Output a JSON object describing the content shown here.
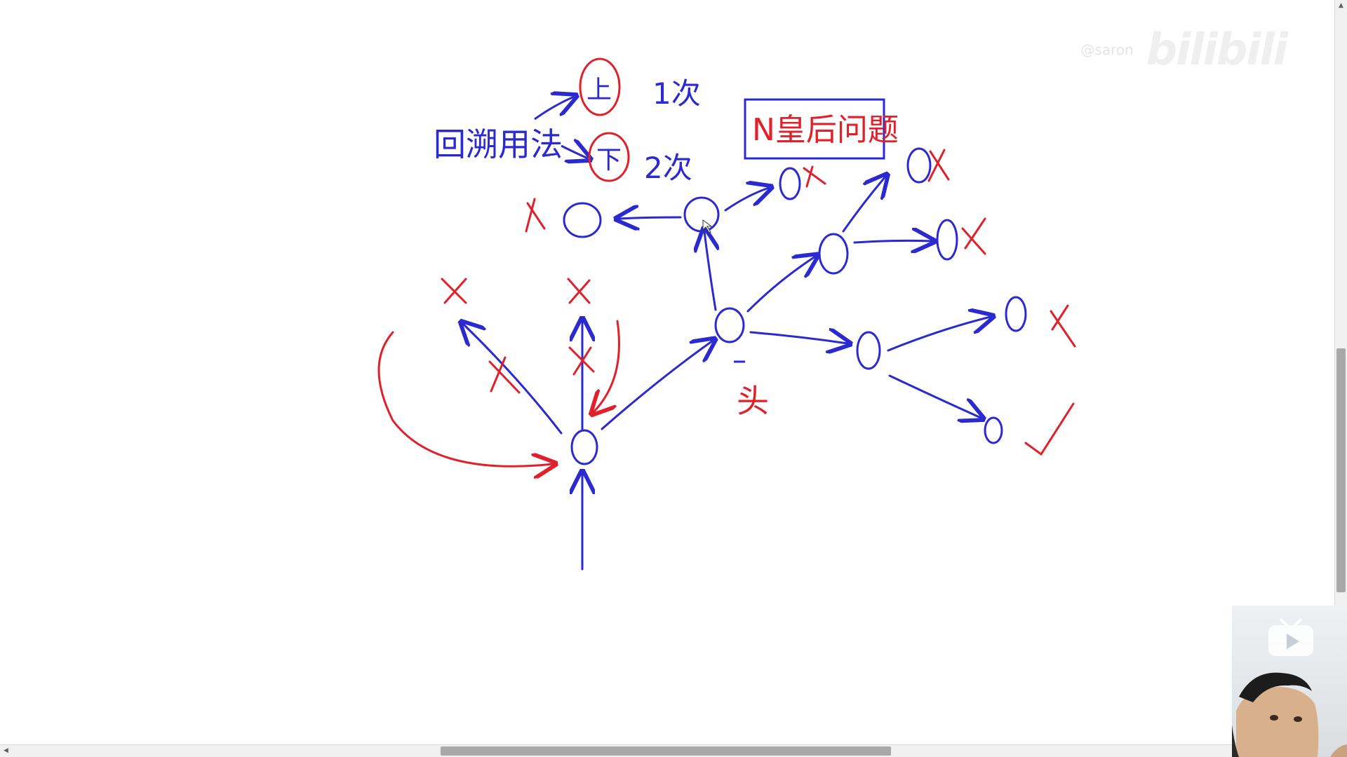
{
  "whiteboard": {
    "title_box": "N皇后问题",
    "method_label": "回溯用法",
    "branch_up": "上",
    "branch_down": "下",
    "count_up": "1次",
    "count_down": "2次",
    "dead_end_label": "头",
    "colors": {
      "blue_ink": "#2a2ad0",
      "red_ink": "#e0202a",
      "box_border": "#2a2ad0"
    }
  },
  "watermark": {
    "username": "@saron",
    "logo": "bilibili"
  },
  "webcam": {
    "icon": "tv-play-icon"
  },
  "scrollbars": {
    "up_arrow": "▲",
    "left_arrow": "◀"
  }
}
